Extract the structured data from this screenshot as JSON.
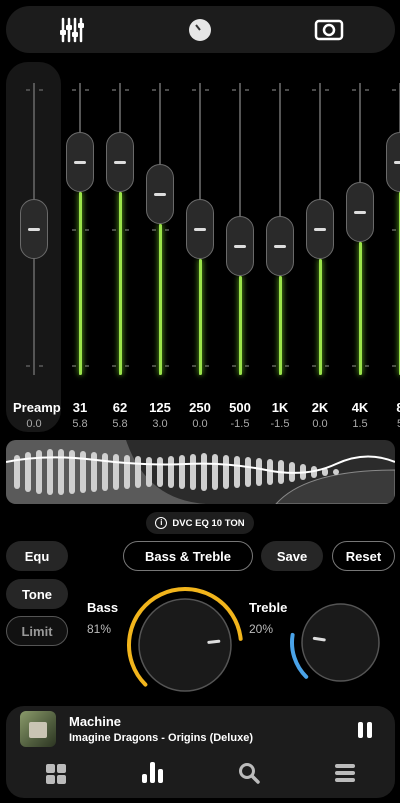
{
  "top_tabs": [
    {
      "name": "equalizer-sliders-icon"
    },
    {
      "name": "knob-icon"
    },
    {
      "name": "speaker-icon"
    }
  ],
  "preamp": {
    "label": "Preamp",
    "value": "0.0",
    "level_db": 0
  },
  "bands": [
    {
      "label": "31",
      "value": "5.8",
      "db": 5.8
    },
    {
      "label": "62",
      "value": "5.8",
      "db": 5.8
    },
    {
      "label": "125",
      "value": "3.0",
      "db": 3.0
    },
    {
      "label": "250",
      "value": "0.0",
      "db": 0.0
    },
    {
      "label": "500",
      "value": "-1.5",
      "db": -1.5
    },
    {
      "label": "1K",
      "value": "-1.5",
      "db": -1.5
    },
    {
      "label": "2K",
      "value": "0.0",
      "db": 0.0
    },
    {
      "label": "4K",
      "value": "1.5",
      "db": 1.5
    },
    {
      "label": "8",
      "value": "5",
      "db": 5.8
    }
  ],
  "preset_name": "DVC EQ 10 TON",
  "left_tabs": {
    "equ": "Equ",
    "tone": "Tone",
    "limit": "Limit"
  },
  "buttons": {
    "bass_treble": "Bass & Treble",
    "save": "Save",
    "reset": "Reset"
  },
  "bass": {
    "label": "Bass",
    "percent": "81%",
    "level": 0.81,
    "color": "#f2b51c"
  },
  "treble": {
    "label": "Treble",
    "percent": "20%",
    "level": 0.2,
    "color": "#4aa3e8"
  },
  "accent_green": "#9be34a",
  "now_playing": {
    "title": "Machine",
    "artist": "Imagine Dragons - Origins (Deluxe)"
  },
  "bottom_nav": [
    "grid-icon",
    "bars-icon",
    "search-icon",
    "menu-icon"
  ]
}
